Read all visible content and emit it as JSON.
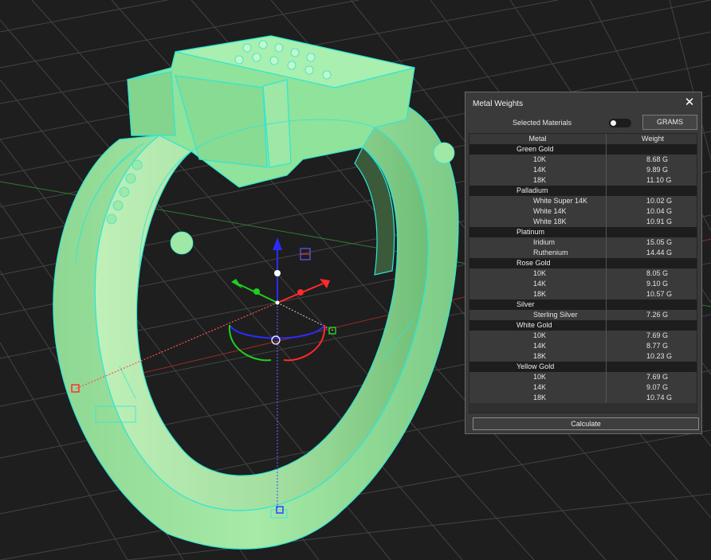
{
  "panel": {
    "title": "Metal Weights",
    "close_icon": "✕",
    "selected_materials_label": "Selected Materials",
    "selected_materials_on": false,
    "units_label": "GRAMS",
    "table": {
      "headers": [
        "Metal",
        "Weight"
      ],
      "groups": [
        {
          "name": "Green Gold",
          "items": [
            {
              "metal": "10K",
              "weight": "8.68 G"
            },
            {
              "metal": "14K",
              "weight": "9.89 G"
            },
            {
              "metal": "18K",
              "weight": "11.10 G"
            }
          ]
        },
        {
          "name": "Palladium",
          "items": [
            {
              "metal": "White Super 14K",
              "weight": "10.02 G"
            },
            {
              "metal": "White 14K",
              "weight": "10.04 G"
            },
            {
              "metal": "White 18K",
              "weight": "10.91 G"
            }
          ]
        },
        {
          "name": "Platinum",
          "items": [
            {
              "metal": "Iridium",
              "weight": "15.05 G"
            },
            {
              "metal": "Ruthenium",
              "weight": "14.44 G"
            }
          ]
        },
        {
          "name": "Rose Gold",
          "items": [
            {
              "metal": "10K",
              "weight": "8.05 G"
            },
            {
              "metal": "14K",
              "weight": "9.10 G"
            },
            {
              "metal": "18K",
              "weight": "10.57 G"
            }
          ]
        },
        {
          "name": "Silver",
          "items": [
            {
              "metal": "Sterling Silver",
              "weight": "7.26 G"
            }
          ]
        },
        {
          "name": "White Gold",
          "items": [
            {
              "metal": "10K",
              "weight": "7.69 G"
            },
            {
              "metal": "14K",
              "weight": "8.77 G"
            },
            {
              "metal": "18K",
              "weight": "10.23 G"
            }
          ]
        },
        {
          "name": "Yellow Gold",
          "items": [
            {
              "metal": "10K",
              "weight": "7.69 G"
            },
            {
              "metal": "14K",
              "weight": "9.07 G"
            },
            {
              "metal": "18K",
              "weight": "10.74 G"
            }
          ]
        }
      ]
    },
    "calculate_label": "Calculate"
  },
  "viewport": {
    "background_color": "#1e1e1e",
    "grid_color": "#4a4a4a",
    "model_fill_color": "#8fe39a",
    "model_wire_color": "#2ee6d6",
    "axis_x_color": "#e02020",
    "axis_y_color": "#20c020",
    "axis_z_color": "#2020e0"
  }
}
